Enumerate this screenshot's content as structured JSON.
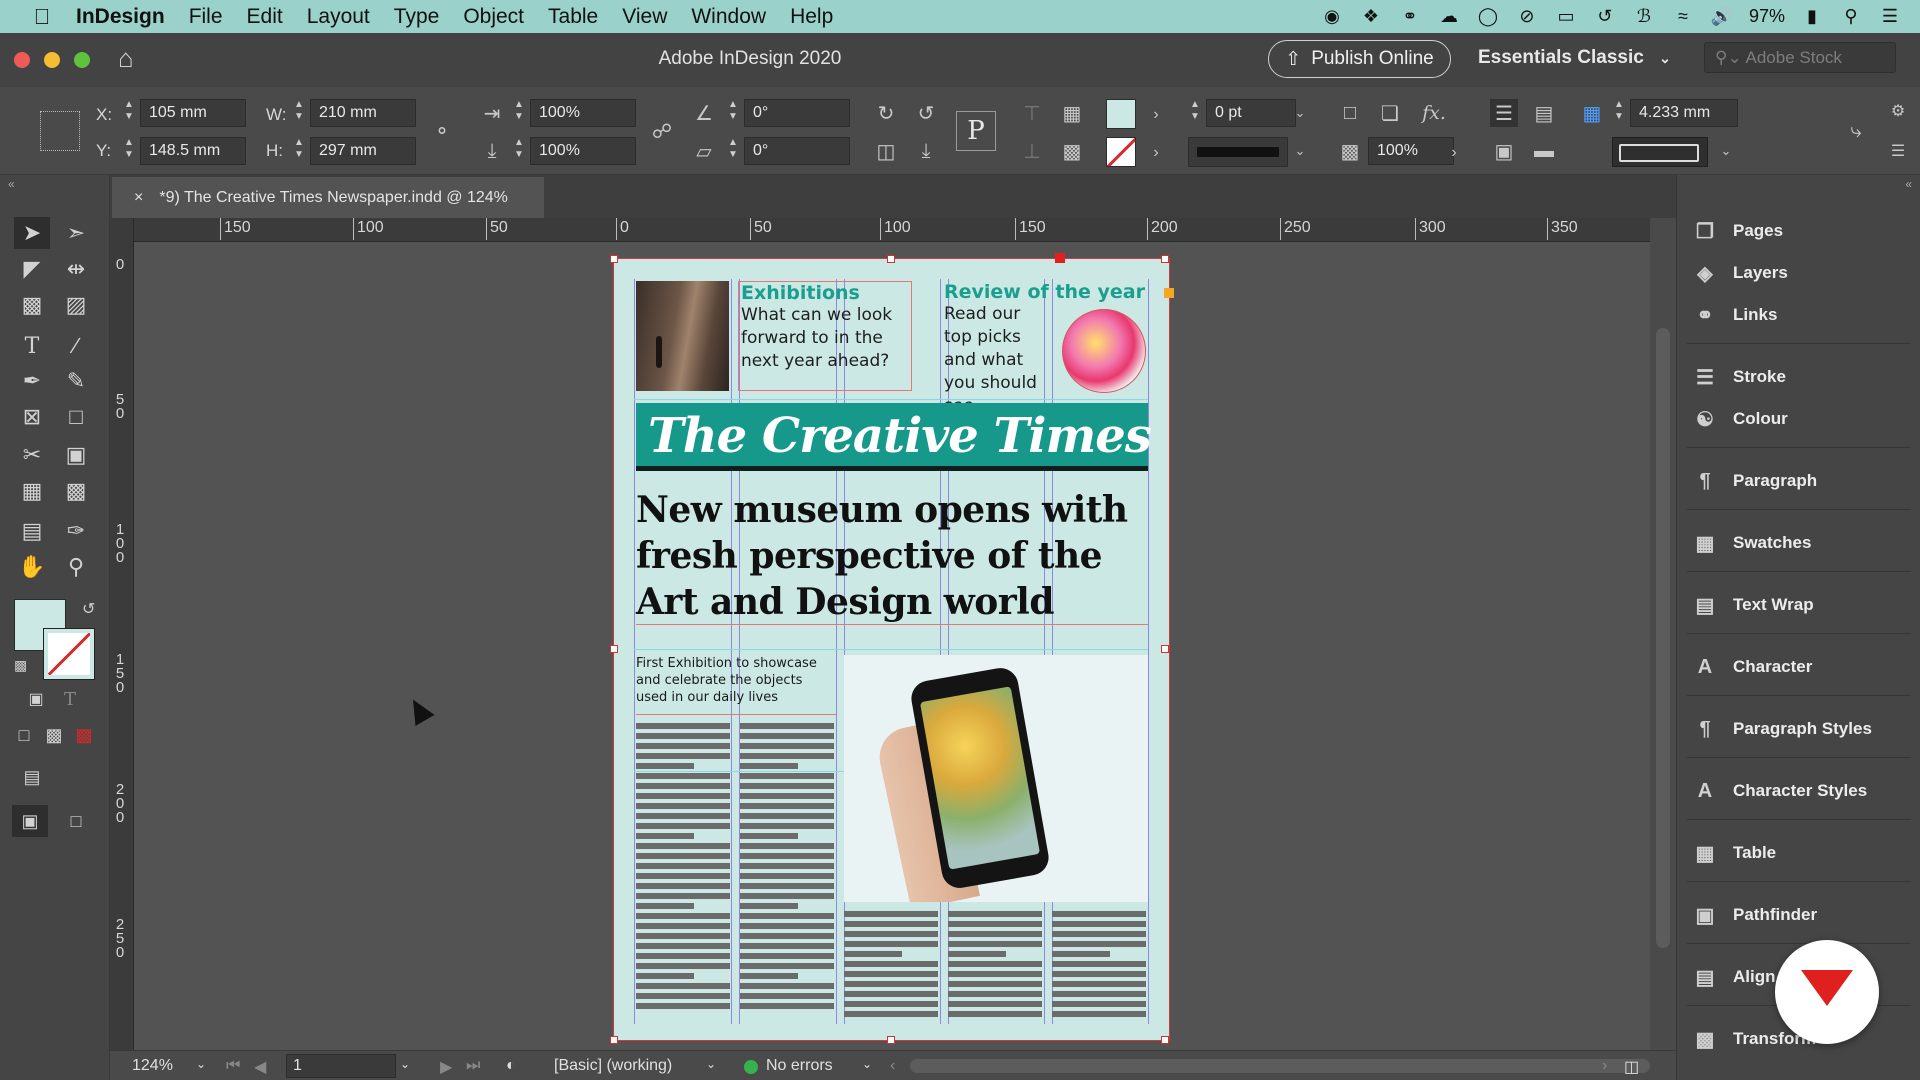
{
  "menubar": {
    "app": "InDesign",
    "items": [
      "File",
      "Edit",
      "Layout",
      "Type",
      "Object",
      "Table",
      "View",
      "Window",
      "Help"
    ],
    "battery": "97%"
  },
  "titlebar": {
    "title": "Adobe InDesign 2020",
    "publish_label": "Publish Online",
    "workspace": "Essentials Classic",
    "stock_placeholder": "Adobe Stock"
  },
  "control": {
    "x_label": "X:",
    "x_value": "105 mm",
    "y_label": "Y:",
    "y_value": "148.5 mm",
    "w_label": "W:",
    "w_value": "210 mm",
    "h_label": "H:",
    "h_value": "297 mm",
    "scale_x": "100%",
    "scale_y": "100%",
    "rotate": "0°",
    "shear": "0°",
    "stroke_weight": "0 pt",
    "opacity": "100%",
    "gap": "4.233 mm"
  },
  "document": {
    "tab_title": "*9) The Creative Times Newspaper.indd @ 124%",
    "close_label": "×"
  },
  "rulers": {
    "h": [
      "150",
      "100",
      "50",
      "0",
      "50",
      "100",
      "150",
      "200",
      "250",
      "300",
      "350"
    ],
    "v": [
      "0",
      "5 0",
      "1 0 0",
      "1 5 0",
      "2 0 0",
      "2 5 0"
    ]
  },
  "page": {
    "exhibitions_head": "Exhibitions",
    "exhibitions_body": "What can we look forward to in the next year ahead?",
    "review_head": "Review of the year",
    "review_body": "Read our top picks and what you should see",
    "masthead": "The Creative Times",
    "headline": "New museum opens with fresh perspective of the Art and Design world",
    "deck": "First Exhibition to showcase and celebrate the objects used in our daily lives"
  },
  "panels": {
    "items": [
      "Pages",
      "Layers",
      "Links",
      "Stroke",
      "Colour",
      "Paragraph",
      "Swatches",
      "Text Wrap",
      "Character",
      "Paragraph Styles",
      "Character Styles",
      "Table",
      "Pathfinder",
      "Align",
      "Transform"
    ]
  },
  "status": {
    "zoom": "124%",
    "page": "1",
    "style": "[Basic] (working)",
    "errors": "No errors"
  },
  "colors": {
    "page_bg": "#cbe8e4",
    "masthead_bg": "#16988a",
    "accent_teal": "#1a9e8e",
    "menubar_bg": "#9ad2cb"
  }
}
